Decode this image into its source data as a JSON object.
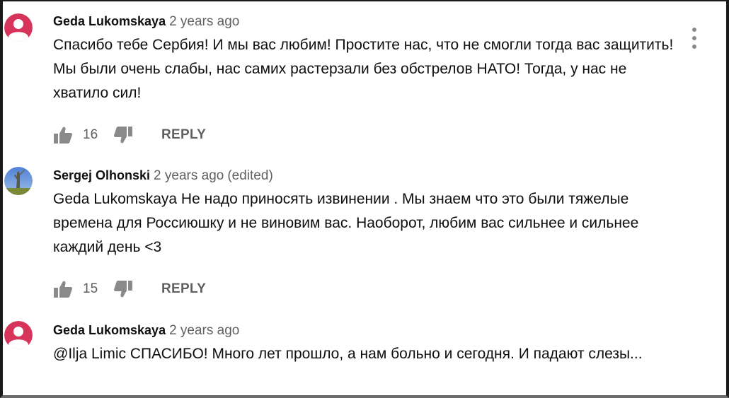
{
  "comments": [
    {
      "author": "Geda Lukomskaya",
      "time": "2 years ago",
      "edited": "",
      "text": "Спасибо тебе Сербия! И мы вас любим! Простите нас, что не смогли тогда вас защитить! Мы были очень слабы, нас самих растерзали без обстрелов НАТО! Тогда,  у нас не хватило сил!",
      "likes": "16",
      "reply": "REPLY",
      "avatar_color": "#d6345a"
    },
    {
      "author": "Sergej Olhonski",
      "time": "2 years ago",
      "edited": "(edited)",
      "text": "Geda Lukomskaya Не надо приносять извинении . Мы знаем что это были тяжелые времена для Россиюшку и не виновим вас. Наоборот, любим вас сильнее и сильнее каждий день <3",
      "likes": "15",
      "reply": "REPLY"
    },
    {
      "author": "Geda Lukomskaya",
      "time": "2 years ago",
      "edited": "",
      "text": "@Ilja Limic СПАСИБО! Много лет прошло, а нам больно и сегодня. И падают слезы...",
      "avatar_color": "#d6345a"
    }
  ],
  "icons": {
    "like": "thumb-up-icon",
    "dislike": "thumb-down-icon",
    "menu": "more-vertical-icon"
  }
}
